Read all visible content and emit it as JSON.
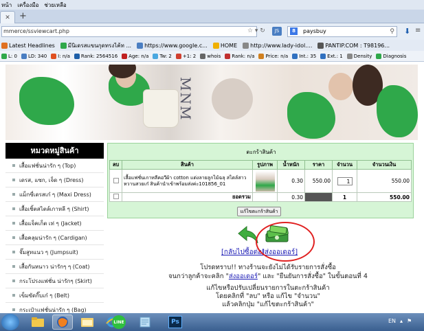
{
  "browser": {
    "menu": [
      "หน้า",
      "เครื่องมือ",
      "ช่วยเหลือ"
    ],
    "new_tab": "+",
    "url": "mmerce/ssviewcart.php",
    "js_badge": "JS",
    "search_value": "paysbuy",
    "bookmarks": [
      {
        "label": "Latest Headlines",
        "color": "#e07020"
      },
      {
        "label": "มีนิเดรสแขนกุดทรงไค้ท ...",
        "color": "#2fa84a"
      },
      {
        "label": "https://www.google.c...",
        "color": "#4a7ec2"
      },
      {
        "label": "HOME",
        "color": "#f0b000"
      },
      {
        "label": "http://www.lady-idol....",
        "color": "#888888"
      },
      {
        "label": "PANTIP.COM : T98196...",
        "color": "#555555"
      }
    ],
    "seo": [
      {
        "label": "L: 0",
        "color": "#2fa84a"
      },
      {
        "label": "LD: 340",
        "color": "#4a7ec2"
      },
      {
        "label": "I: n/a",
        "color": "#e05020"
      },
      {
        "label": "Rank: 2564516",
        "color": "#1e5fa8"
      },
      {
        "label": "Age: n/a",
        "color": "#c02020"
      },
      {
        "label": "Tw: 2",
        "color": "#4aa8e0"
      },
      {
        "label": "+1: 2",
        "color": "#d04030"
      },
      {
        "label": "whois",
        "color": "#666666"
      },
      {
        "label": "Rank: n/a",
        "color": "#c03030"
      },
      {
        "label": "Price: n/a",
        "color": "#d08020"
      },
      {
        "label": "Int.: 35",
        "color": "#3070c0"
      },
      {
        "label": "Ext.: 1",
        "color": "#3070c0"
      },
      {
        "label": "Density",
        "color": "#888888"
      },
      {
        "label": "Diagnosis",
        "color": "#2fa84a"
      }
    ]
  },
  "banner": {
    "mnm": "MNM"
  },
  "sidebar": {
    "title": "หมวดหมู่สินค้า",
    "items": [
      "เสื้อแฟชั่นน่ารัก ๆ (Top)",
      "เดรส, แซก, เจ็ด ๆ (Dress)",
      "แม็กซี่เดรสเก๋ ๆ (Maxi Dress)",
      "เสื้อเชิ้ตสไตล์เกาหลี ๆ (Shirt)",
      "เสื้อแจ็คเก็ต เท่ ๆ (Jacket)",
      "เสื้อคลุมน่ารัก ๆ (Cardigan)",
      "จั๊มสูทแนว ๆ (Jumpsuit)",
      "เสื้อกันหนาว น่ารักๆ ๆ (Coat)",
      "กระโปรงแฟชั่น น่ารักๆ (Skirt)",
      "เข็มขัดกิ๊บเก๋ ๆ (Belt)",
      "กระเป๋าแฟชั่นน่ารัก ๆ (Bag)"
    ]
  },
  "cart": {
    "title": "ตะกร้าสินค้า",
    "headers": [
      "ลบ",
      "สินค้า",
      "รูปภาพ",
      "น้ำหนัก",
      "ราคา",
      "จำนวน",
      "จำนวนเงิน"
    ],
    "item": {
      "name": "เสื้อแฟชั่นเกาหลีคอวีผ้า cotton แต่งลายลูกไม้ฉลุ สไตล์สาวหวานสวยเก๋ สินค้านำเข้าพร้อมส่งค่ะ101856_01",
      "weight": "0.30",
      "price": "550.00",
      "qty": "1",
      "total": "550.00"
    },
    "summary": {
      "label": "ยอดรวม",
      "weight": "0.30",
      "qty": "1",
      "total": "550.00"
    },
    "update_button": "แก้ไขตะกร้าสินค้า"
  },
  "actions": {
    "back_link": "[กลับไปซื้อต่อ]",
    "order_link": "[ส่งออเดอร์]"
  },
  "notice": {
    "line1": "โปรดทราบ!! ทางร้านจะยังไม่ได้รับรายการสั่งซื้อ",
    "line2_a": "จนกว่าลูกค้าจะคลิก \"",
    "line2_link": "ส่งออเดอร์",
    "line2_b": "\" และ \"ยืนยันการสั่งซื้อ\" ในขั้นตอนที่ 4",
    "line3": "แก้ไขหรือปรับเปลี่ยนรายการในตะกร้าสินค้า",
    "line4": "โดยคลิกที่ \"ลบ\" หรือ แก้ไข \"จำนวน\"",
    "line5": "แล้วคลิกปุ่ม \"แก้ไขตะกร้าสินค้า\""
  },
  "taskbar": {
    "ps_label": "Ps",
    "line_label": "LINE",
    "lang": "EN",
    "apps": [
      "folder-app",
      "firefox-app",
      "explorer-app",
      "ie-app",
      "line-app",
      "notes-app",
      "photoshop-app"
    ]
  }
}
